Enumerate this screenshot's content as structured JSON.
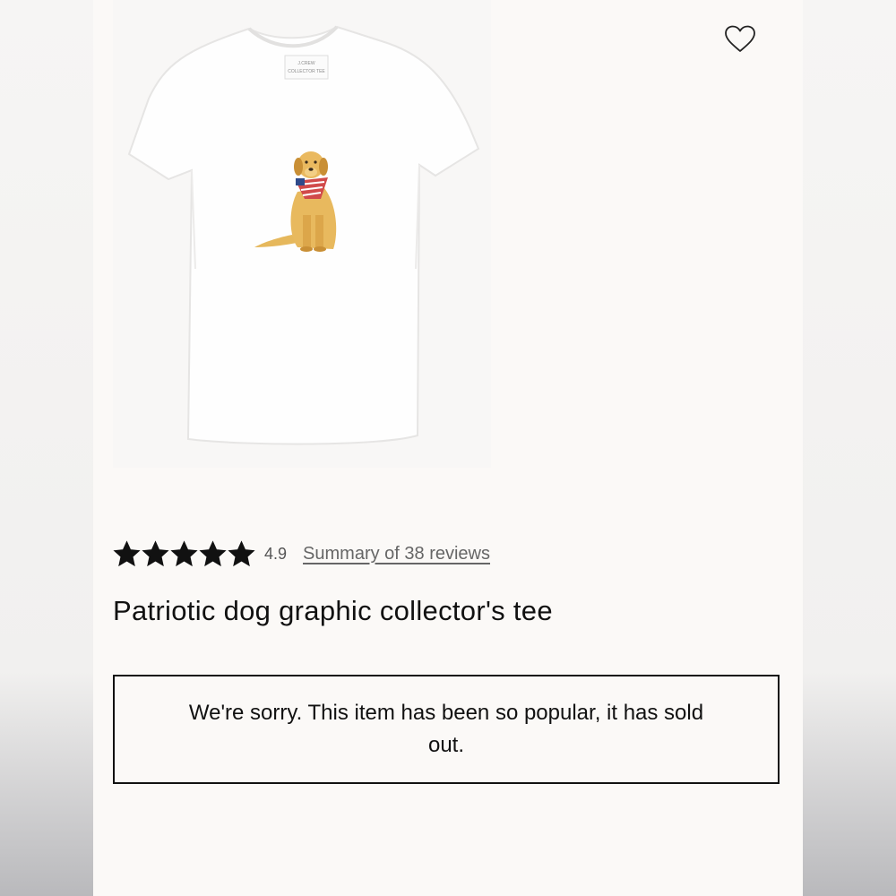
{
  "product": {
    "image_alt": "Patriotic dog graphic collector's tee",
    "title": "Patriotic dog graphic collector's tee",
    "tag_brand": "J.CREW",
    "tag_line": "COLLECTOR TEE"
  },
  "rating": {
    "value": "4.9",
    "stars_filled": 5,
    "stars_total": 5,
    "reviews_link": "Summary of 38 reviews"
  },
  "wishlist": {
    "icon": "heart-outline-icon"
  },
  "availability": {
    "message": "We're sorry. This item has been so popular, it has sold out."
  }
}
